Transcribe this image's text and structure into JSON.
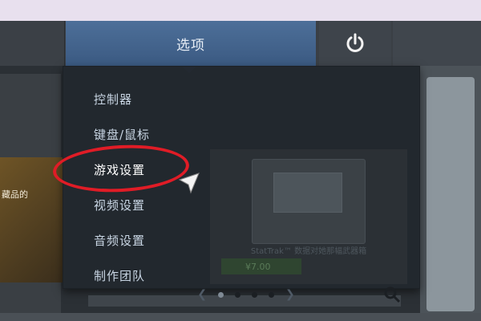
{
  "nav": {
    "options_label": "选项",
    "power_icon": "power-icon"
  },
  "menu": {
    "items": [
      {
        "label": "控制器"
      },
      {
        "label": "键盘/鼠标"
      },
      {
        "label": "游戏设置"
      },
      {
        "label": "视频设置"
      },
      {
        "label": "音频设置"
      },
      {
        "label": "制作团队"
      }
    ]
  },
  "background": {
    "card_left_text": "藏品的",
    "item_caption": "StatTrak™ 数据对她那幅武器箱",
    "item_price": "¥7.00"
  },
  "colors": {
    "accent": "#3b5a82",
    "highlight": "#e01c26"
  }
}
